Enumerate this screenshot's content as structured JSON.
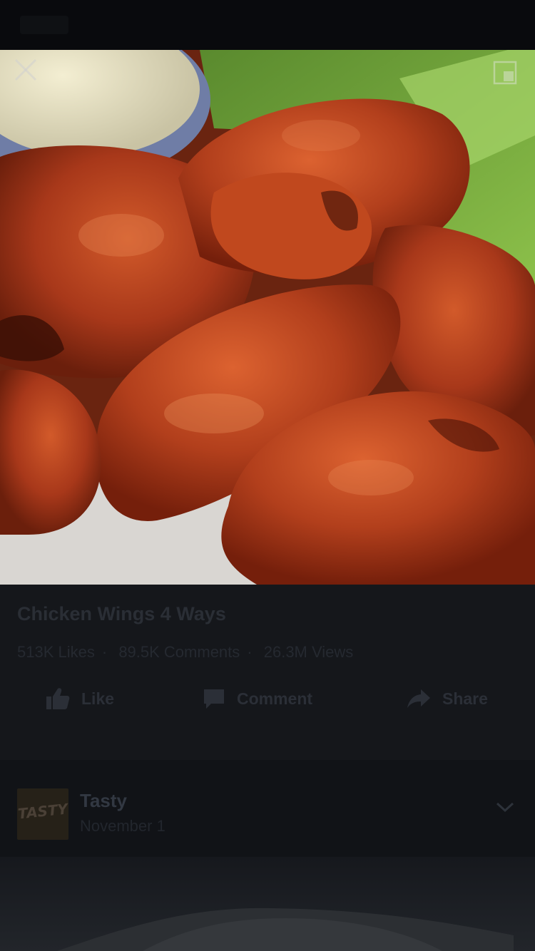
{
  "video": {
    "close_icon": "close-icon",
    "pip_icon": "picture-in-picture-icon"
  },
  "post": {
    "title": "Chicken Wings 4 Ways",
    "likes": "513K Likes",
    "comments": "89.5K Comments",
    "views": "26.3M Views"
  },
  "actions": {
    "like_label": "Like",
    "comment_label": "Comment",
    "share_label": "Share"
  },
  "page": {
    "name": "Tasty",
    "date": "November 1",
    "avatar_text": "TASTY"
  },
  "colors": {
    "background": "#15171b",
    "dimmed_text": "#2a2e35"
  }
}
